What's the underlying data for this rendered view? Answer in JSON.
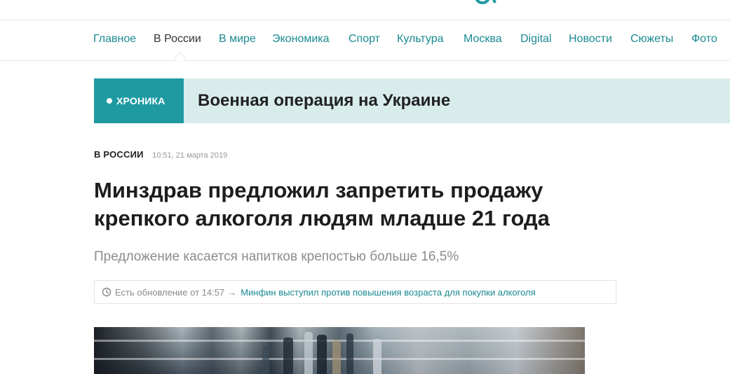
{
  "nav": {
    "items": [
      {
        "label": "Главное",
        "active": false
      },
      {
        "label": "В России",
        "active": true
      },
      {
        "label": "В мире",
        "active": false
      },
      {
        "label": "Экономика",
        "active": false
      },
      {
        "label": "Спорт",
        "active": false
      },
      {
        "label": "Культура",
        "active": false
      },
      {
        "label": "Москва",
        "active": false
      },
      {
        "label": "Digital",
        "active": false
      },
      {
        "label": "Новости",
        "active": false
      },
      {
        "label": "Сюжеты",
        "active": false
      },
      {
        "label": "Фото",
        "active": false
      }
    ]
  },
  "chronicle": {
    "badge": "ХРОНИКА",
    "title": "Военная операция на Украине"
  },
  "article": {
    "section": "В РОССИИ",
    "datetime": "10:51, 21 марта 2019",
    "headline": "Минздрав предложил запретить продажу крепкого алкоголя людям младше 21 года",
    "lead": "Предложение касается напитков крепостью больше 16,5%",
    "update": {
      "prefix": "Есть обновление от 14:57",
      "arrow": "→",
      "link": "Минфин выступил против повышения возраста для покупки алкоголя"
    }
  },
  "colors": {
    "accent": "#1b8a92",
    "badge_bg": "#1f9aa3",
    "chronicle_bg": "#d9ecec"
  },
  "icons": {
    "update": "clock-icon",
    "badge": "dot-icon",
    "logo": "logo-fragment"
  }
}
